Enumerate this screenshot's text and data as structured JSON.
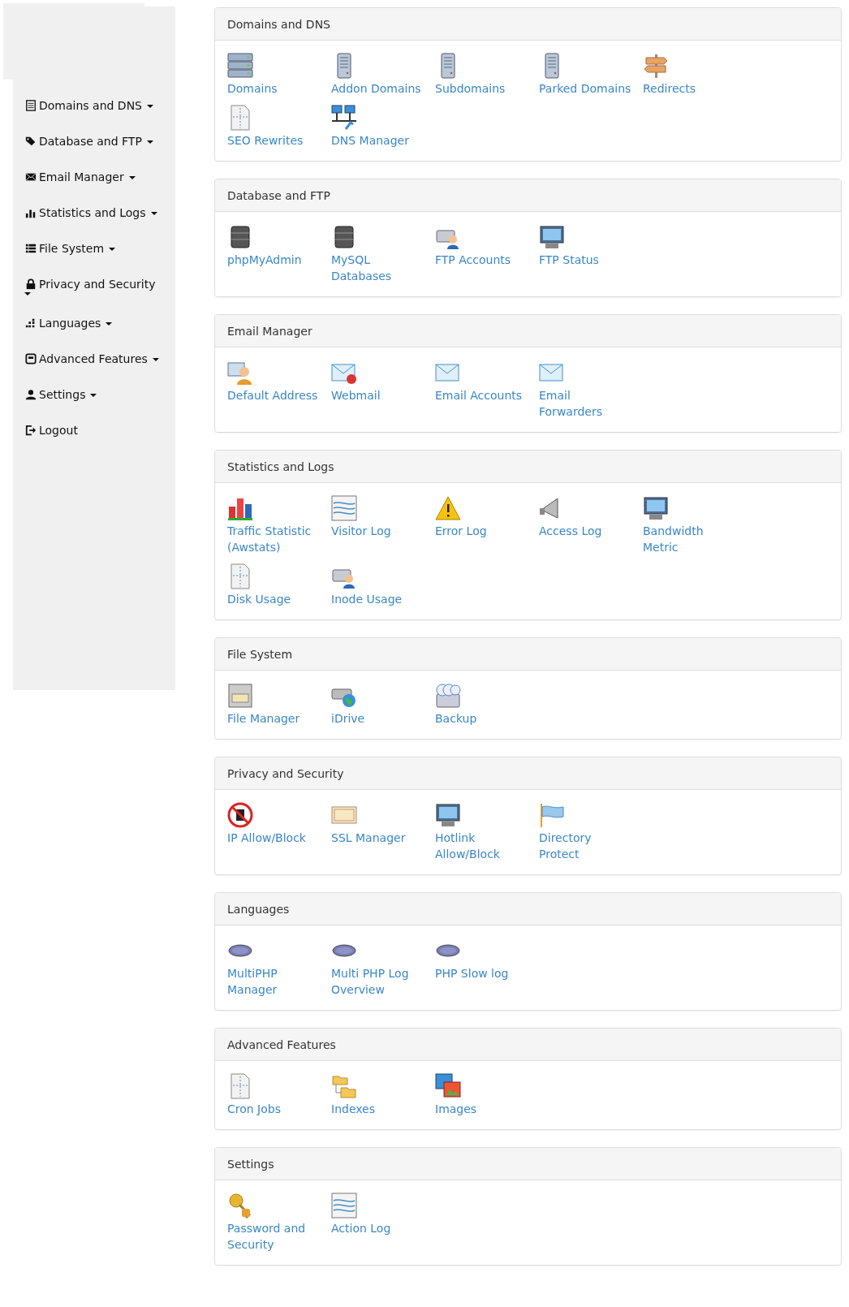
{
  "sidebar": {
    "items": [
      {
        "label": "Domains and DNS",
        "dropdown": true
      },
      {
        "label": "Database and FTP",
        "dropdown": true
      },
      {
        "label": "Email Manager",
        "dropdown": true
      },
      {
        "label": "Statistics and Logs",
        "dropdown": true
      },
      {
        "label": "File System",
        "dropdown": true
      },
      {
        "label": "Privacy and Security",
        "dropdown": true
      },
      {
        "label": "Languages",
        "dropdown": true
      },
      {
        "label": "Advanced Features",
        "dropdown": true
      },
      {
        "label": "Settings",
        "dropdown": true
      },
      {
        "label": "Logout",
        "dropdown": false
      }
    ]
  },
  "sections": [
    {
      "title": "Domains and DNS",
      "items": [
        "Domains",
        "Addon Domains",
        "Subdomains",
        "Parked Domains",
        "Redirects",
        "SEO Rewrites",
        "DNS Manager"
      ]
    },
    {
      "title": "Database and FTP",
      "items": [
        "phpMyAdmin",
        "MySQL Databases",
        "FTP Accounts",
        "FTP Status"
      ]
    },
    {
      "title": "Email Manager",
      "items": [
        "Default Address",
        "Webmail",
        "Email Accounts",
        "Email Forwarders"
      ]
    },
    {
      "title": "Statistics and Logs",
      "items": [
        "Traffic Statistic (Awstats)",
        "Visitor Log",
        "Error Log",
        "Access Log",
        "Bandwidth Metric",
        "Disk Usage",
        "Inode Usage"
      ]
    },
    {
      "title": "File System",
      "items": [
        "File Manager",
        "iDrive",
        "Backup"
      ]
    },
    {
      "title": "Privacy and Security",
      "items": [
        "IP Allow/Block",
        "SSL Manager",
        "Hotlink Allow/Block",
        "Directory Protect"
      ]
    },
    {
      "title": "Languages",
      "items": [
        "MultiPHP Manager",
        "Multi PHP Log Overview",
        "PHP Slow log"
      ]
    },
    {
      "title": "Advanced Features",
      "items": [
        "Cron Jobs",
        "Indexes",
        "Images"
      ]
    },
    {
      "title": "Settings",
      "items": [
        "Password and Security",
        "Action Log"
      ]
    }
  ]
}
